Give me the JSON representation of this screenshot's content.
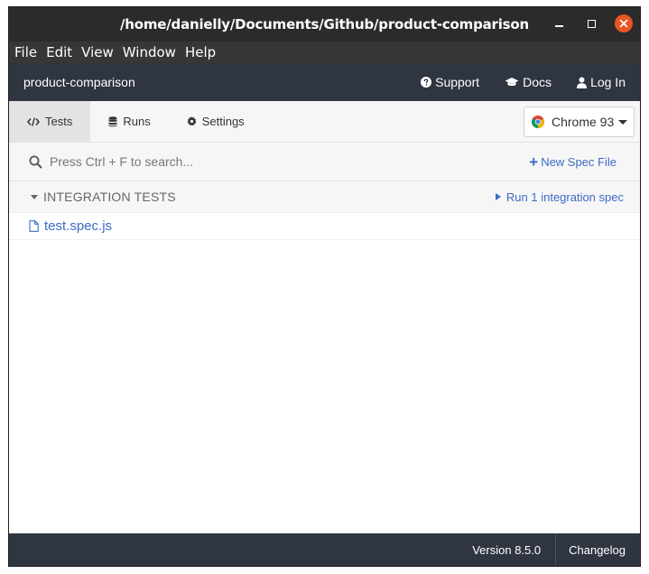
{
  "window": {
    "title": "/home/danielly/Documents/Github/product-comparison"
  },
  "menu": {
    "items": [
      "File",
      "Edit",
      "View",
      "Window",
      "Help"
    ]
  },
  "header": {
    "project": "product-comparison",
    "support": "Support",
    "docs": "Docs",
    "login": "Log In"
  },
  "tabs": [
    {
      "label": "Tests",
      "icon": "code-icon",
      "active": true
    },
    {
      "label": "Runs",
      "icon": "database-icon",
      "active": false
    },
    {
      "label": "Settings",
      "icon": "gear-icon",
      "active": false
    }
  ],
  "browser": {
    "selected": "Chrome 93",
    "icon": "chrome-icon"
  },
  "search": {
    "placeholder": "Press Ctrl + F to search...",
    "value": ""
  },
  "new_spec": {
    "label": "New Spec File"
  },
  "integration": {
    "title": "INTEGRATION TESTS",
    "run_label": "Run 1 integration spec",
    "specs": [
      "test.spec.js"
    ]
  },
  "footer": {
    "version": "Version 8.5.0",
    "changelog": "Changelog"
  },
  "colors": {
    "titlebar": "#2b2b2b",
    "menubar": "#373737",
    "app_header": "#2f3541",
    "link": "#3d6bc6",
    "close_button": "#e95420"
  }
}
